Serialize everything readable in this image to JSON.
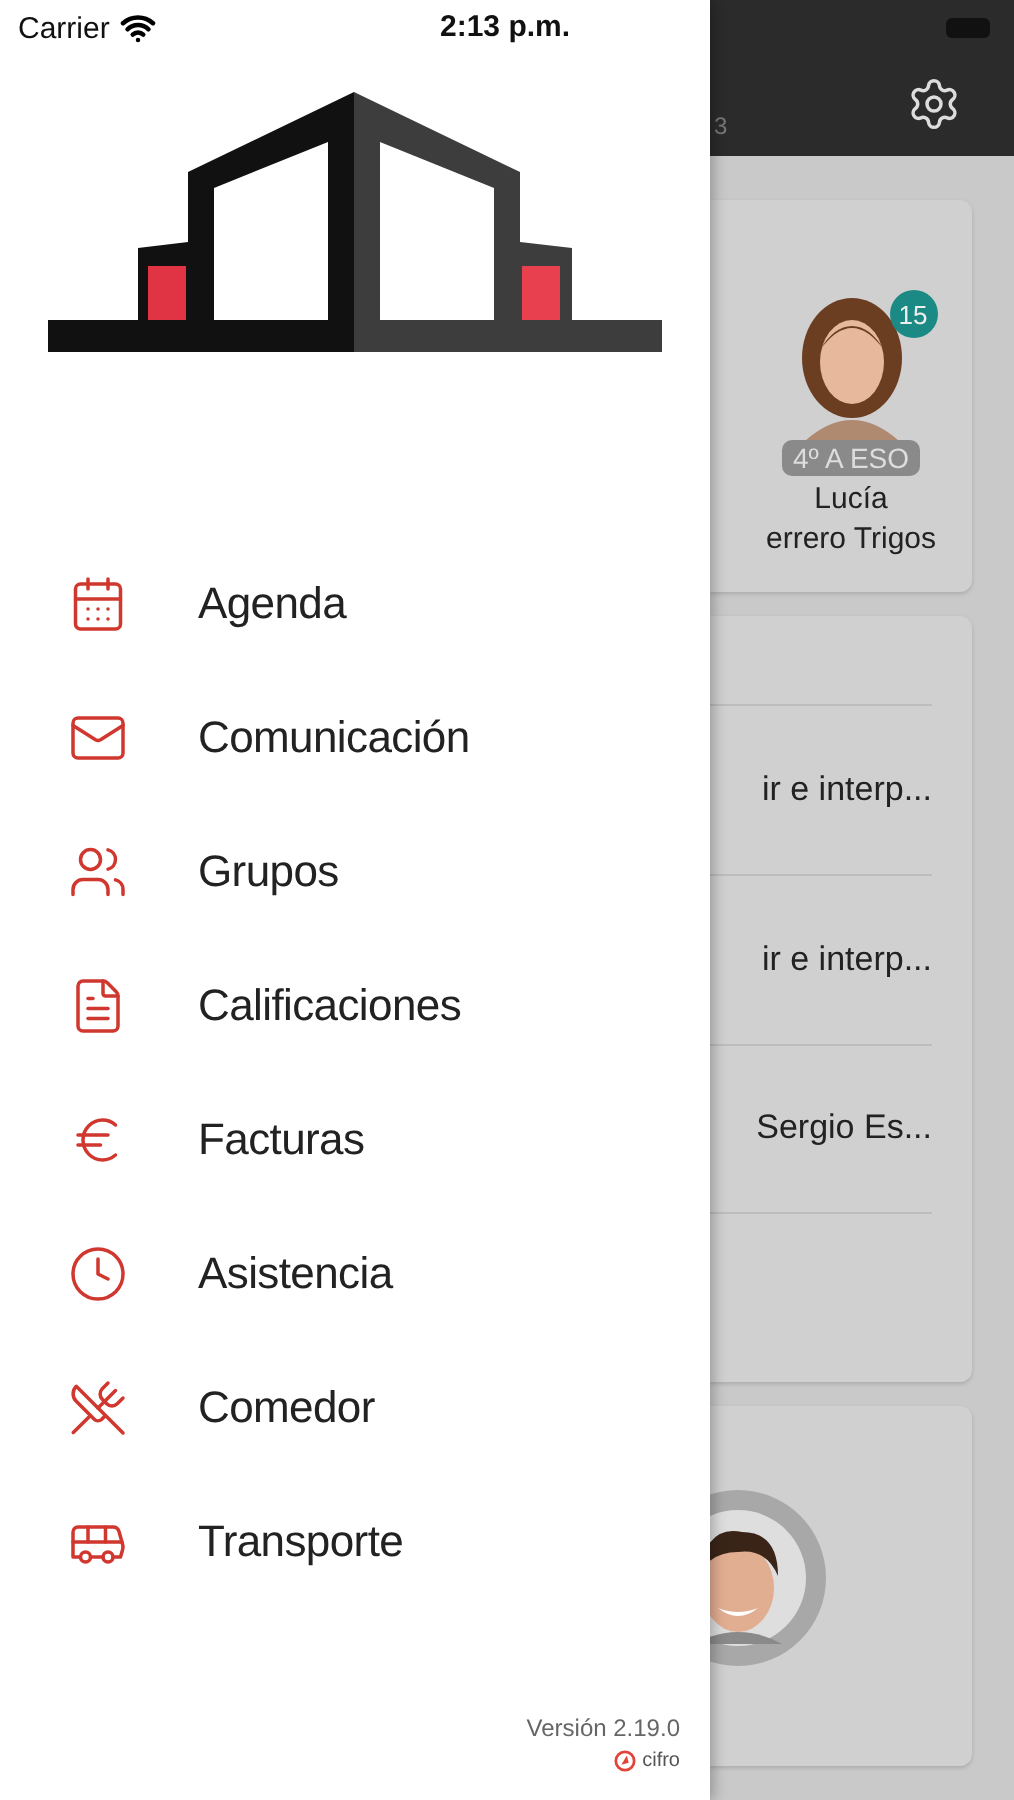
{
  "status_bar": {
    "carrier": "Carrier",
    "time": "2:13 p.m."
  },
  "menu": [
    {
      "label": "Agenda"
    },
    {
      "label": "Comunicación"
    },
    {
      "label": "Grupos"
    },
    {
      "label": "Calificaciones"
    },
    {
      "label": "Facturas"
    },
    {
      "label": "Asistencia"
    },
    {
      "label": "Comedor"
    },
    {
      "label": "Transporte"
    }
  ],
  "footer": {
    "version": "Versión 2.19.0",
    "brand": "cifro"
  },
  "background": {
    "header_fragment": "3",
    "student": {
      "badge": "15",
      "group": "4º A ESO",
      "first_name": "Lucía",
      "last_name": "errero Trigos"
    },
    "messages": [
      "ir e interp...",
      "ir e interp...",
      "Sergio Es..."
    ]
  }
}
